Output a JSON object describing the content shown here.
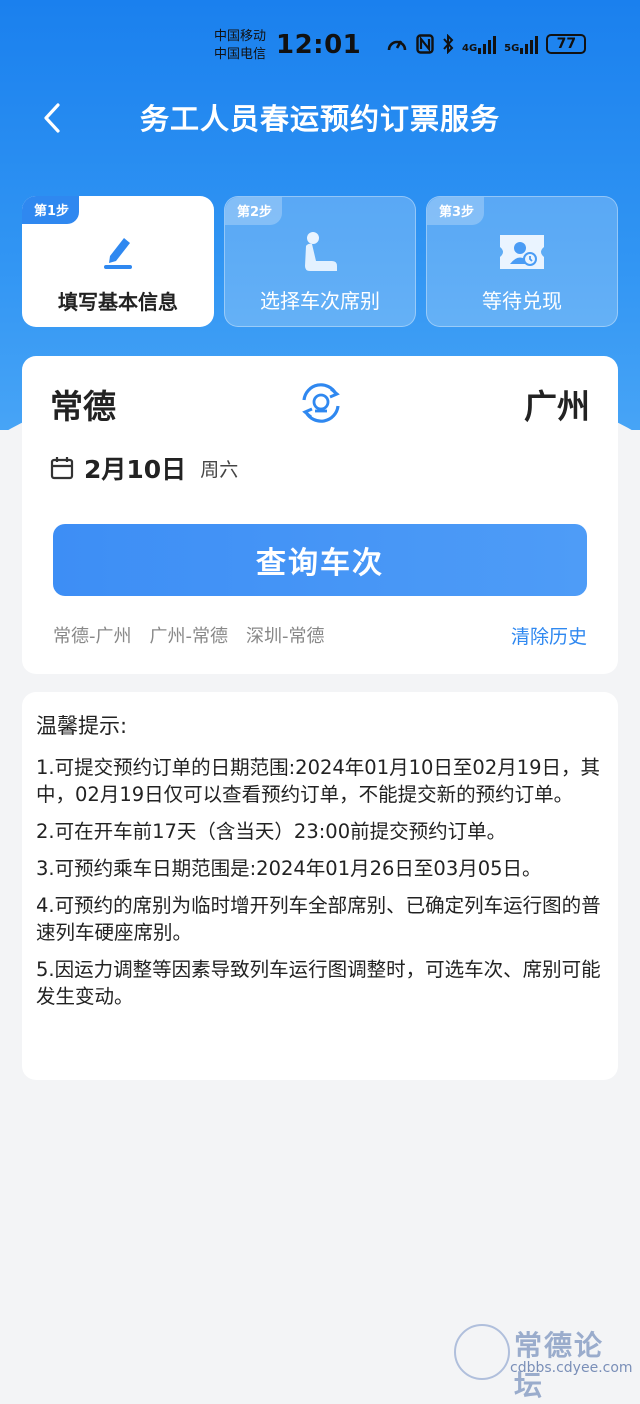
{
  "status_bar": {
    "carrier1": "中国移动",
    "carrier2": "中国电信",
    "time": "12:01",
    "net1": "4G",
    "net2": "5G",
    "battery": "77"
  },
  "header": {
    "title": "务工人员春运预约订票服务"
  },
  "steps": [
    {
      "badge": "第1步",
      "label": "填写基本信息",
      "icon": "pen-icon"
    },
    {
      "badge": "第2步",
      "label": "选择车次席别",
      "icon": "seat-icon"
    },
    {
      "badge": "第3步",
      "label": "等待兑现",
      "icon": "ticket-icon"
    }
  ],
  "search": {
    "from": "常德",
    "to": "广州",
    "date": "2月10日",
    "weekday": "周六",
    "query_button": "查询车次",
    "history": [
      "常德-广州",
      "广州-常德",
      "深圳-常德"
    ],
    "clear_history": "清除历史"
  },
  "tips": {
    "title": "温馨提示:",
    "items": [
      "1.可提交预约订单的日期范围:2024年01月10日至02月19日，其中，02月19日仅可以查看预约订单，不能提交新的预约订单。",
      "2.可在开车前17天（含当天）23:00前提交预约订单。",
      "3.可预约乘车日期范围是:2024年01月26日至03月05日。",
      "4.可预约的席别为临时增开列车全部席别、已确定列车运行图的普速列车硬座席别。",
      "5.因运力调整等因素导致列车运行图调整时，可选车次、席别可能发生变动。"
    ]
  },
  "watermark": {
    "name": "常德论坛",
    "url": "cdbbs.cdyee.com"
  },
  "colors": {
    "primary": "#2f88f0",
    "header_bg": "#1a80ee",
    "page_bg": "#f3f4f6"
  }
}
